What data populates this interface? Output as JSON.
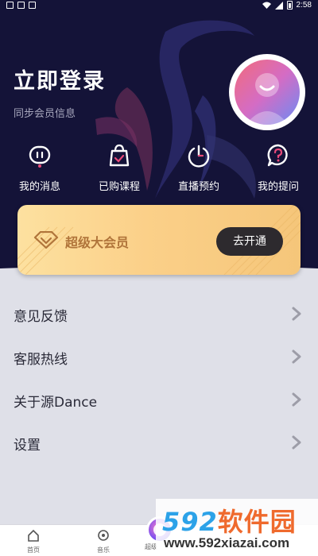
{
  "status_bar": {
    "time": "2:58"
  },
  "profile": {
    "login_title": "立即登录",
    "login_subtitle": "同步会员信息"
  },
  "quick_actions": [
    {
      "label": "我的消息",
      "icon": "message-icon"
    },
    {
      "label": "已购课程",
      "icon": "shopping-bag-icon"
    },
    {
      "label": "直播预约",
      "icon": "power-clock-icon"
    },
    {
      "label": "我的提问",
      "icon": "question-icon"
    }
  ],
  "vip": {
    "label": "超级大会员",
    "button_label": "去开通",
    "colors": {
      "gold_light": "#fde1a0",
      "gold_dark": "#f5c67a",
      "text": "#b0743a",
      "button": "#2d2a2e"
    }
  },
  "menu": [
    {
      "label": "意见反馈"
    },
    {
      "label": "客服热线"
    },
    {
      "label": "关于源Dance"
    },
    {
      "label": "设置"
    }
  ],
  "tabbar": {
    "tabs": [
      {
        "label": "首页",
        "icon": "home-icon"
      },
      {
        "label": "音乐",
        "icon": "music-icon"
      },
      {
        "label": "超级",
        "icon": "center-play-icon"
      }
    ]
  },
  "watermark": {
    "brand_number": "592",
    "brand_text": "软件园",
    "url": "www.592xiazai.com"
  },
  "theme": {
    "header_bg": "#141338",
    "panel_bg": "#dfe0e8",
    "accent": "#6a8cf4"
  }
}
